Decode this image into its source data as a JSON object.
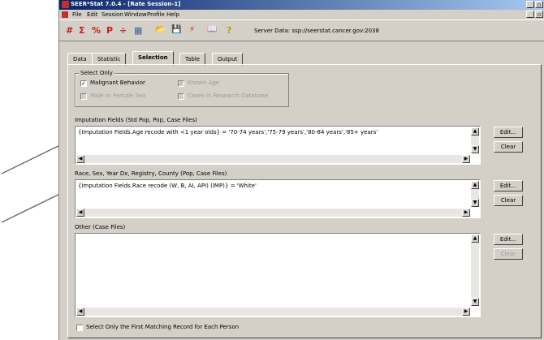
{
  "window": {
    "title": "SEER*Stat 7.0.4 - [Rate Session-1]"
  },
  "menu": [
    "File",
    "Edit",
    "Session",
    "Window",
    "Profile",
    "Help"
  ],
  "toolbar": {
    "icons": [
      "hash-icon",
      "sigma-icon",
      "percent-icon",
      "p-icon",
      "divide-icon",
      "grid-icon",
      "open-folder-icon",
      "save-icon",
      "lightning-icon",
      "book-icon",
      "help-icon"
    ],
    "glyphs": [
      "#",
      "Σ",
      "%",
      "P",
      "÷",
      "▦",
      "📂",
      "💾",
      "⚡",
      "📖",
      "?"
    ],
    "server_label": "Server Data: ssp://seerstat.cancer.gov:2038"
  },
  "tabs": [
    "Data",
    "Statistic",
    "Selection",
    "Table",
    "Output"
  ],
  "active_tab": "Selection",
  "select_only": {
    "label": "Select Only",
    "options": [
      {
        "label": "Malignant Behavior",
        "checked": true,
        "enabled": true
      },
      {
        "label": "Known Age",
        "checked": true,
        "enabled": false
      },
      {
        "label": "Male or Female Sex",
        "checked": false,
        "enabled": false
      },
      {
        "label": "Cases in Research Database",
        "checked": false,
        "enabled": false
      }
    ]
  },
  "sections": [
    {
      "label": "Imputation Fields (Std Pop, Pop, Case Files)",
      "text": "{Imputation Fields.Age recode with <1 year olds} = '70-74 years','75-79 years','80-84 years','85+ years'",
      "edit": "Edit...",
      "clear": "Clear",
      "clear_enabled": true
    },
    {
      "label": "Race, Sex, Year Dx, Registry, County (Pop, Case Files)",
      "text": "{Imputation Fields.Race recode (W, B, AI, API) (IMP)} = 'White'",
      "edit": "Edit...",
      "clear": "Clear",
      "clear_enabled": true
    },
    {
      "label": "Other (Case Files)",
      "text": "",
      "edit": "Edit...",
      "clear": "Clear",
      "clear_enabled": false
    }
  ],
  "footer_checkbox": {
    "label": "Select Only the First Matching Record for Each Person",
    "checked": false
  },
  "colors": {
    "titlebar_start": "#0a246a",
    "titlebar_end": "#a6caf0",
    "face": "#d4d0c8",
    "arrow": "#6e6e6e"
  }
}
